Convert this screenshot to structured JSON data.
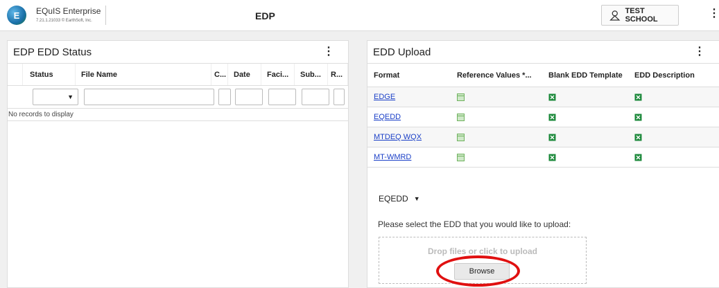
{
  "header": {
    "logo_letter": "E",
    "app_name": "EQuIS Enterprise",
    "app_version": "7.21.1.21033 © EarthSoft, Inc.",
    "page_title": "EDP",
    "org_button": "TEST SCHOOL"
  },
  "status_panel": {
    "title": "EDP EDD Status",
    "columns": [
      "Status",
      "File Name",
      "C...",
      "Date",
      "Faci...",
      "Sub...",
      "R..."
    ],
    "empty_message": "No records to display"
  },
  "upload_panel": {
    "title": "EDD Upload",
    "columns": [
      "Format",
      "Reference Values *...",
      "Blank EDD Template",
      "EDD Description"
    ],
    "rows": [
      {
        "format": "EDGE"
      },
      {
        "format": "EQEDD"
      },
      {
        "format": "MTDEQ WQX"
      },
      {
        "format": "MT-WMRD"
      }
    ],
    "selected_format": "EQEDD",
    "prompt": "Please select the EDD that you would like to upload:",
    "dropzone_text": "Drop files or click to upload",
    "browse_label": "Browse"
  },
  "colors": {
    "link": "#1a3fc7",
    "highlight": "#e01010",
    "excel_green": "#1e8a3c"
  }
}
